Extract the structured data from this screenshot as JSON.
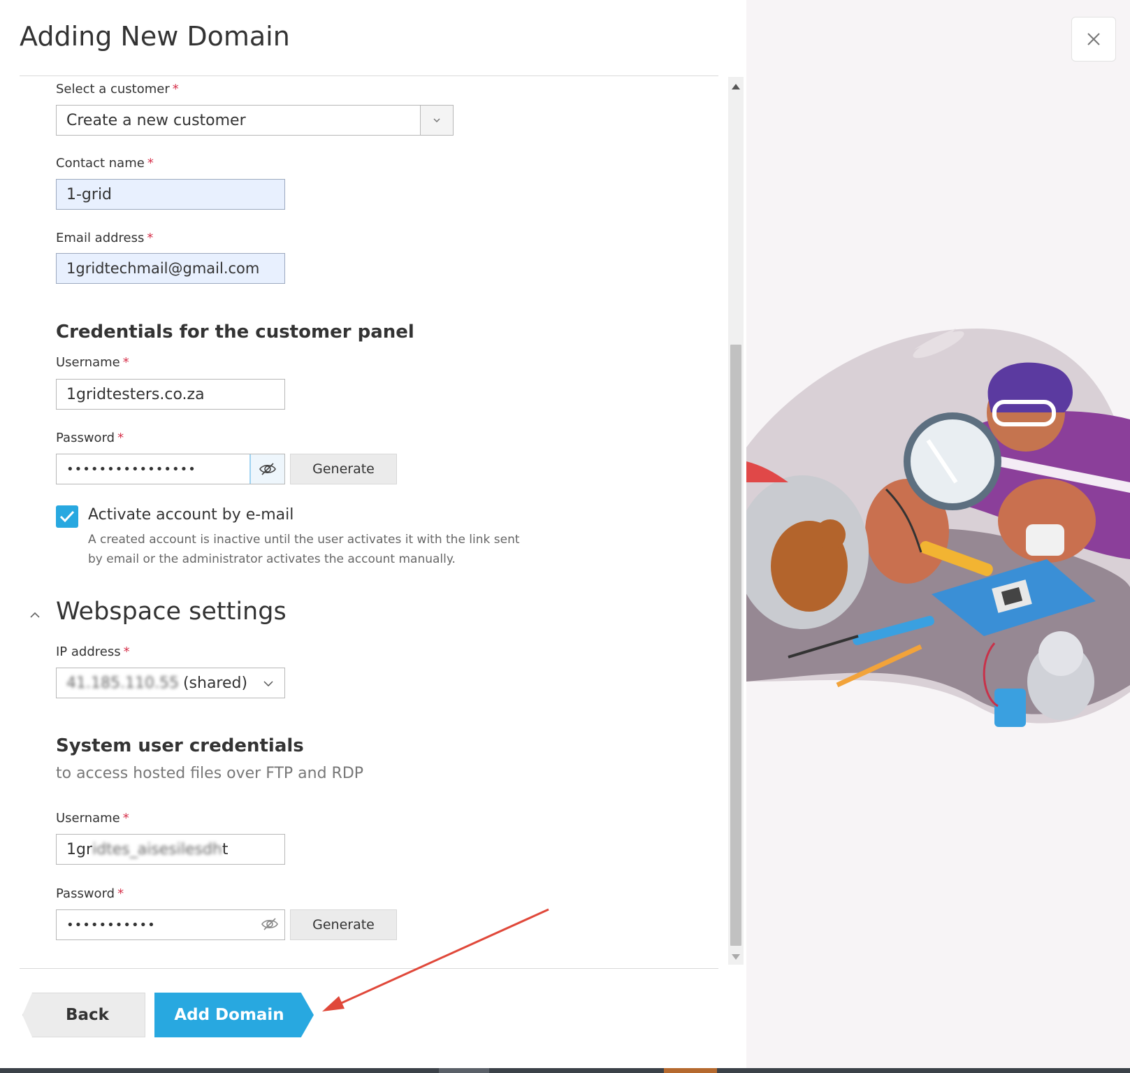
{
  "dialog": {
    "title": "Adding New Domain"
  },
  "customer": {
    "select_label": "Select a customer",
    "select_value": "Create a new customer",
    "contact_label": "Contact name",
    "contact_value": "1-grid",
    "email_label": "Email address",
    "email_value": "1gridtechmail@gmail.com"
  },
  "panel_credentials": {
    "title": "Credentials for the customer panel",
    "username_label": "Username",
    "username_value": "1gridtesters.co.za",
    "password_label": "Password",
    "password_value": "••••••••••••••••",
    "generate_label": "Generate",
    "activate_checked": true,
    "activate_label": "Activate account by e-mail",
    "activate_hint_line1": "A created account is inactive until the user activates it with the link sent",
    "activate_hint_line2": "by email or the administrator activates the account manually."
  },
  "webspace": {
    "title": "Webspace settings",
    "ip_label": "IP address",
    "ip_value_obscured": "41.185.110.55",
    "ip_suffix": "(shared)"
  },
  "system_user": {
    "title": "System user credentials",
    "subtitle": "to access hosted files over FTP and RDP",
    "username_label": "Username",
    "username_prefix": "1gr",
    "username_obscured": "idtes_aisesilesdh",
    "username_suffix": "t",
    "password_label": "Password",
    "password_value": "•••••••••••",
    "generate_label": "Generate"
  },
  "footer": {
    "back_label": "Back",
    "add_label": "Add Domain"
  },
  "required_mark": "*",
  "colors": {
    "accent": "#28a8e0",
    "required": "#d6314b",
    "autofill": "#e8f0fe",
    "annotation_arrow": "#e0483a"
  }
}
